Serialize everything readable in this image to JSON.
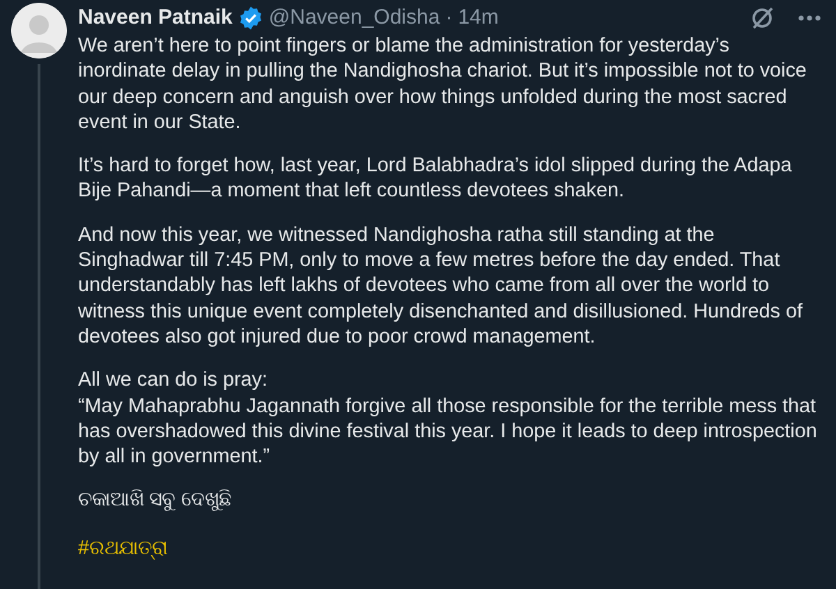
{
  "post": {
    "author": "Naveen Patnaik",
    "verified": true,
    "handle": "@Naveen_Odisha",
    "separator": "·",
    "time": "14m",
    "paragraphs": [
      "We aren’t here to point fingers or blame the administration for yesterday’s inordinate delay in pulling the Nandighosha chariot. But it’s impossible not to voice our deep concern and anguish over how things unfolded during the most sacred event in our State.",
      "It’s hard to forget how, last year, Lord Balabhadra’s idol slipped during the Adapa Bije Pahandi—a moment that left countless devotees shaken.",
      "And now this year, we witnessed Nandighosha ratha still standing at the Singhadwar till 7:45 PM, only to move a few metres before the day ended. That understandably has left lakhs of devotees who came from all over the world to witness this unique event completely disenchanted and disillusioned. Hundreds of devotees also got injured due to poor crowd management.",
      "All we can do is pray:\n“May Mahaprabhu Jagannath forgive all those responsible for the terrible mess that has overshadowed this divine festival this year. I hope it leads to deep introspection by all in government.”",
      "ଚକାଆଖି ସବୁ ଦେଖୁଛି"
    ],
    "hashtag": "#ରଥଯାତ୍ରା"
  }
}
